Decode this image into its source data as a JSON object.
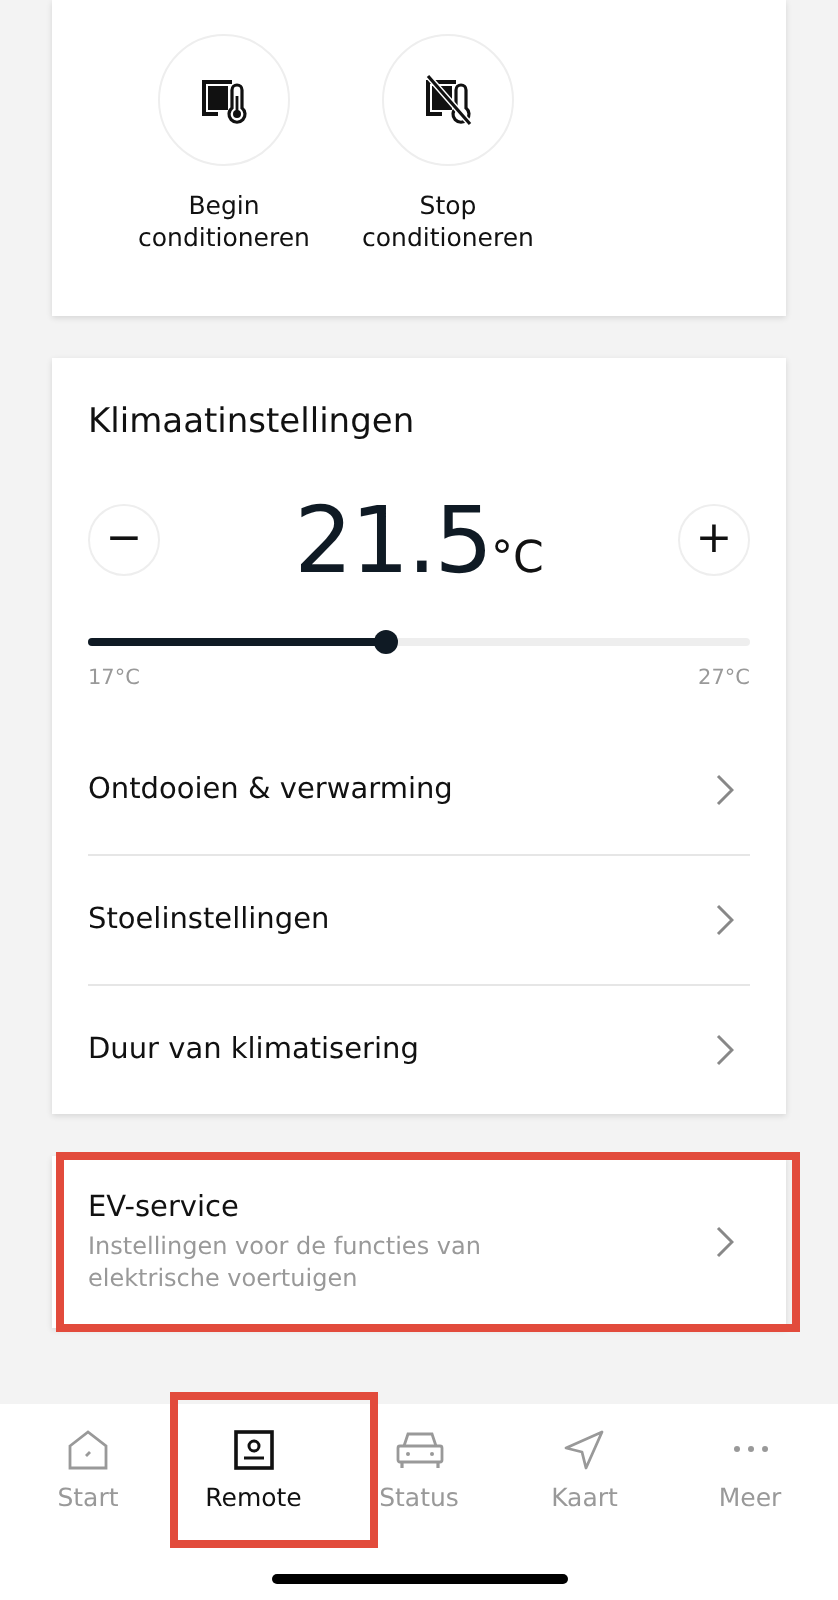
{
  "quick_actions": [
    {
      "kind": "start",
      "label": "Begin conditioneren"
    },
    {
      "kind": "stop",
      "label": "Stop conditioneren"
    }
  ],
  "climate": {
    "title": "Klimaatinstellingen",
    "decrease": "−",
    "temperature": "21.5",
    "unit": "°C",
    "increase": "+",
    "level": 0.45,
    "min_label": "17°C",
    "max_label": "27°C",
    "items": [
      {
        "label": "Ontdooien & verwarming"
      },
      {
        "label": "Stoelinstellingen"
      },
      {
        "label": "Duur van klimatisering"
      }
    ]
  },
  "ev_service": {
    "title": "EV-service",
    "subtitle": "Instellingen voor de functies van elektrische voertuigen",
    "highlighted": true
  },
  "tabs": [
    {
      "kind": "home",
      "label": "Start",
      "selected": false,
      "highlighted": false
    },
    {
      "kind": "remote",
      "label": "Remote",
      "selected": true,
      "highlighted": true
    },
    {
      "kind": "car",
      "label": "Status",
      "selected": false,
      "highlighted": false
    },
    {
      "kind": "map",
      "label": "Kaart",
      "selected": false,
      "highlighted": false
    },
    {
      "kind": "more",
      "label": "Meer",
      "selected": false,
      "highlighted": false
    }
  ]
}
